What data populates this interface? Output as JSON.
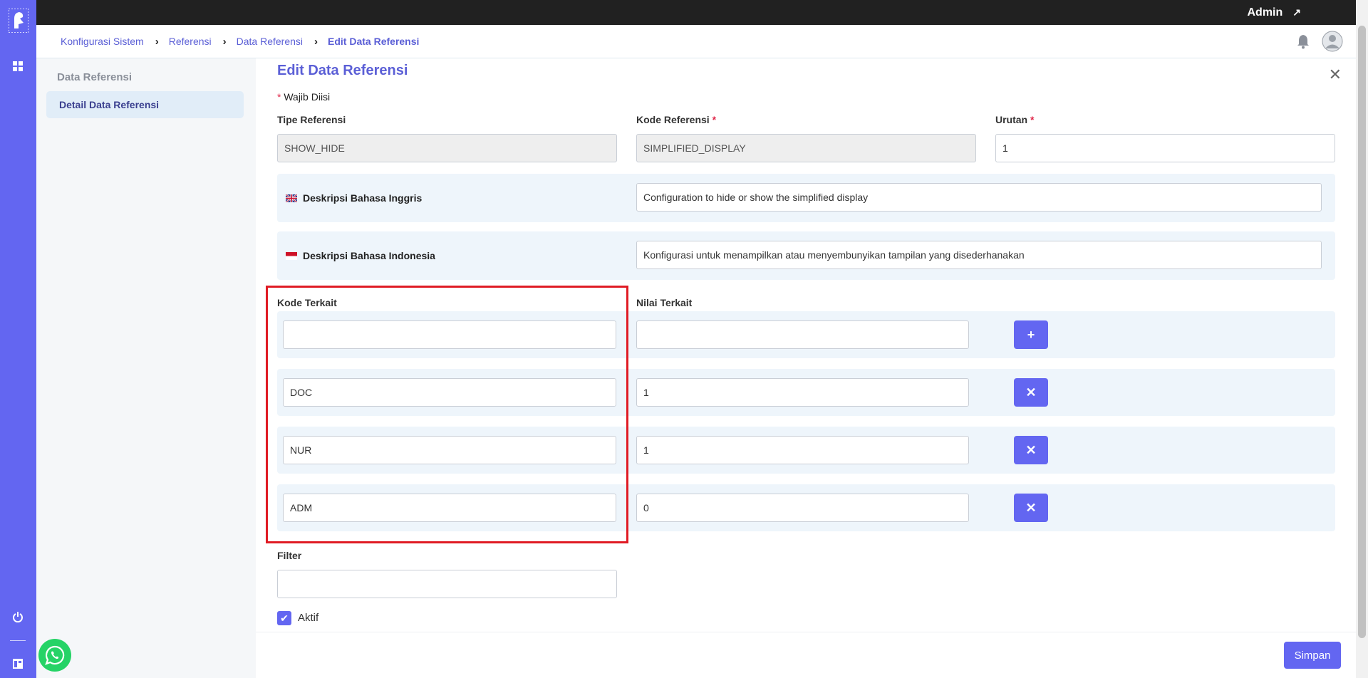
{
  "topbar": {
    "user_name": "Admin",
    "user_menu_icon": "arrow-up-right-icon"
  },
  "breadcrumb": [
    "Konfigurasi Sistem",
    "Referensi",
    "Data Referensi",
    "Edit Data Referensi"
  ],
  "sidebar": {
    "title": "Data Referensi",
    "items": [
      {
        "label": "Detail Data Referensi",
        "active": true
      }
    ]
  },
  "form": {
    "title": "Edit Data Referensi",
    "required_note": "Wajib Diisi",
    "tipe_referensi": {
      "label": "Tipe Referensi",
      "value": "SHOW_HIDE",
      "disabled": true
    },
    "kode_referensi": {
      "label": "Kode Referensi",
      "value": "SIMPLIFIED_DISPLAY",
      "disabled": true,
      "required": true
    },
    "urutan": {
      "label": "Urutan",
      "value": "1",
      "required": true
    },
    "desc_en": {
      "label": "Deskripsi Bahasa Inggris",
      "value": "Configuration to hide or show the simplified display"
    },
    "desc_id": {
      "label": "Deskripsi Bahasa Indonesia",
      "value": "Konfigurasi untuk menampilkan atau menyembunyikan tampilan yang disederhanakan"
    },
    "related": {
      "kode_label": "Kode Terkait",
      "nilai_label": "Nilai Terkait",
      "new_row": {
        "kode": "",
        "nilai": "",
        "button": "+"
      },
      "rows": [
        {
          "kode": "DOC",
          "nilai": "1",
          "button": "✕"
        },
        {
          "kode": "NUR",
          "nilai": "1",
          "button": "✕"
        },
        {
          "kode": "ADM",
          "nilai": "0",
          "button": "✕"
        }
      ]
    },
    "filter": {
      "label": "Filter",
      "value": ""
    },
    "aktif": {
      "label": "Aktif",
      "checked": true
    },
    "save_label": "Simpan"
  },
  "colors": {
    "accent": "#6366f1",
    "topbar": "#212121",
    "required": "#e0284a",
    "highlight": "#e01b24",
    "panel": "#eef5fb"
  }
}
